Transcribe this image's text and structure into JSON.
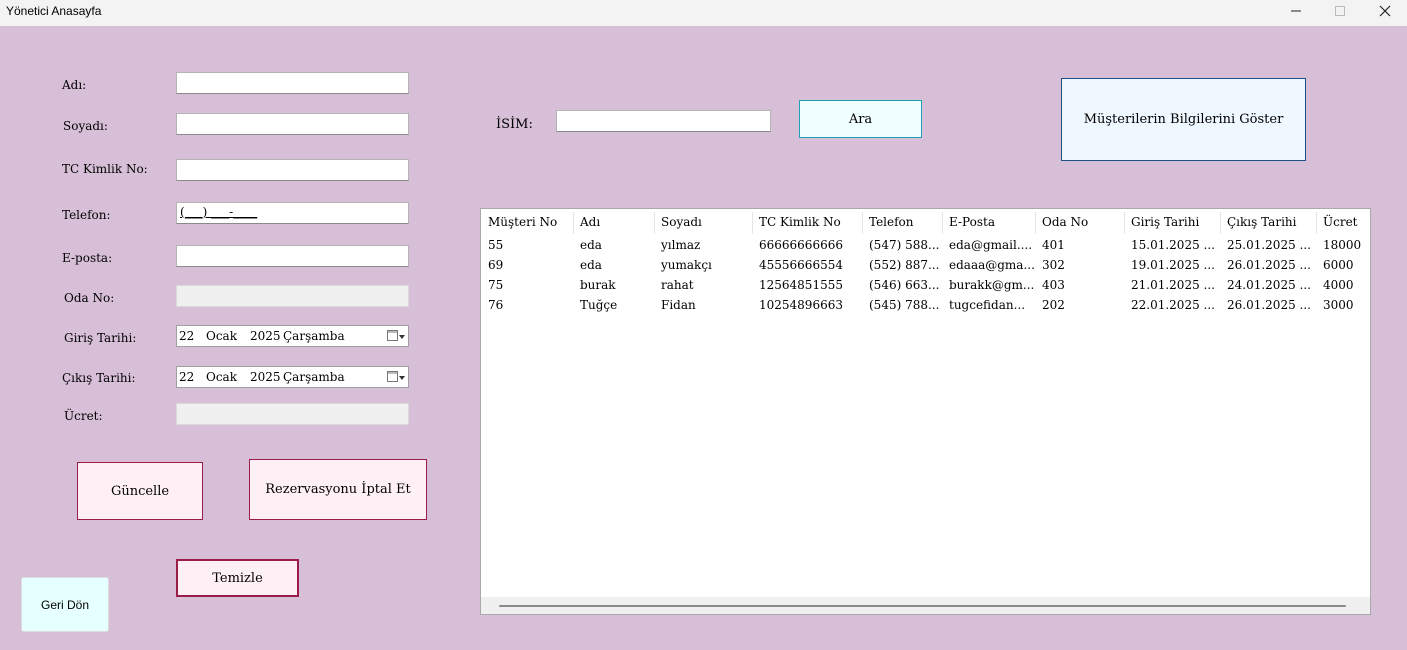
{
  "window": {
    "title": "Yönetici Anasayfa",
    "buttons": {
      "minimize": "—",
      "maximize": "☐",
      "close": "✕"
    }
  },
  "form": {
    "ad_label": "Adı:",
    "ad_value": "",
    "soyad_label": "Soyadı:",
    "soyad_value": "",
    "tc_label": "TC Kimlik No:",
    "tc_value": "",
    "telefon_label": "Telefon:",
    "telefon_mask": "(___) ___-____",
    "eposta_label": "E-posta:",
    "eposta_value": "",
    "odano_label": "Oda No:",
    "odano_value": "",
    "giris_label": "Giriş Tarihi:",
    "giris_date": {
      "day": "22",
      "month": "Ocak",
      "year": "2025",
      "weekday": "Çarşamba"
    },
    "cikis_label": "Çıkış Tarihi:",
    "cikis_date": {
      "day": "22",
      "month": "Ocak",
      "year": "2025",
      "weekday": "Çarşamba"
    },
    "ucret_label": "Ücret:",
    "ucret_value": ""
  },
  "actions": {
    "guncelle": "Güncelle",
    "iptal": "Rezervasyonu İptal Et",
    "temizle": "Temizle",
    "geri_don": "Geri Dön"
  },
  "search": {
    "label": "İSİM:",
    "value": "",
    "button": "Ara",
    "show_button": "Müşterilerin Bilgilerini Göster"
  },
  "table": {
    "columns": [
      "Müşteri No",
      "Adı",
      "Soyadı",
      "TC Kimlik No",
      "Telefon",
      "E-Posta",
      "Oda No",
      "Giriş Tarihi",
      "Çıkış Tarihi",
      "Ücret"
    ],
    "rows": [
      [
        "55",
        "eda",
        "yılmaz",
        "66666666666",
        "(547) 588...",
        "eda@gmail....",
        "401",
        "15.01.2025 ...",
        "25.01.2025 ...",
        "18000"
      ],
      [
        "69",
        "eda",
        "yumakçı",
        "45556666554",
        "(552) 887...",
        "edaaa@gma...",
        "302",
        "19.01.2025 ...",
        "26.01.2025 ...",
        "6000"
      ],
      [
        "75",
        "burak",
        "rahat",
        "12564851555",
        "(546) 663...",
        "burakk@gm...",
        "403",
        "21.01.2025 ...",
        "24.01.2025 ...",
        "4000"
      ],
      [
        "76",
        "Tuğçe",
        "Fidan",
        "10254896663",
        "(545) 788...",
        "tugcefidan...",
        "202",
        "22.01.2025 ...",
        "26.01.2025 ...",
        "3000"
      ]
    ]
  }
}
